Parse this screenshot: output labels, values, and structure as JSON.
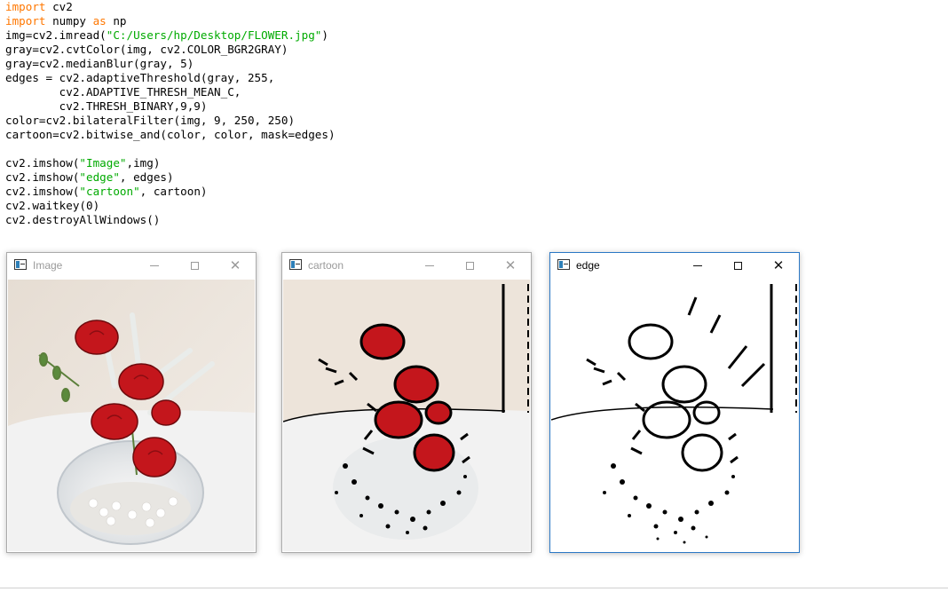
{
  "code_lines": [
    [
      {
        "t": "import",
        "c": "kw"
      },
      {
        "t": " cv2",
        "c": ""
      }
    ],
    [
      {
        "t": "import",
        "c": "kw"
      },
      {
        "t": " numpy ",
        "c": ""
      },
      {
        "t": "as",
        "c": "kw"
      },
      {
        "t": " np",
        "c": ""
      }
    ],
    [
      {
        "t": "img=cv2.imread(",
        "c": ""
      },
      {
        "t": "\"C:/Users/hp/Desktop/FLOWER.jpg\"",
        "c": "str"
      },
      {
        "t": ")",
        "c": ""
      }
    ],
    [
      {
        "t": "gray=cv2.cvtColor(img, cv2.COLOR_BGR2GRAY)",
        "c": ""
      }
    ],
    [
      {
        "t": "gray=cv2.medianBlur(gray, 5)",
        "c": ""
      }
    ],
    [
      {
        "t": "edges = cv2.adaptiveThreshold(gray, 255,",
        "c": ""
      }
    ],
    [
      {
        "t": "        cv2.ADAPTIVE_THRESH_MEAN_C,",
        "c": ""
      }
    ],
    [
      {
        "t": "        cv2.THRESH_BINARY,9,9)",
        "c": ""
      }
    ],
    [
      {
        "t": "color=cv2.bilateralFilter(img, 9, 250, 250)",
        "c": ""
      }
    ],
    [
      {
        "t": "cartoon=cv2.bitwise_and(color, color, mask=edges)",
        "c": ""
      }
    ],
    [],
    [
      {
        "t": "cv2.imshow(",
        "c": ""
      },
      {
        "t": "\"Image\"",
        "c": "str"
      },
      {
        "t": ",img)",
        "c": ""
      }
    ],
    [
      {
        "t": "cv2.imshow(",
        "c": ""
      },
      {
        "t": "\"edge\"",
        "c": "str"
      },
      {
        "t": ", edges)",
        "c": ""
      }
    ],
    [
      {
        "t": "cv2.imshow(",
        "c": ""
      },
      {
        "t": "\"cartoon\"",
        "c": "str"
      },
      {
        "t": ", cartoon)",
        "c": ""
      }
    ],
    [
      {
        "t": "cv2.waitkey(0)",
        "c": ""
      }
    ],
    [
      {
        "t": "cv2.destroyAllWindows()",
        "c": ""
      }
    ]
  ],
  "windows": {
    "image": {
      "title": "Image"
    },
    "cartoon": {
      "title": "cartoon"
    },
    "edge": {
      "title": "edge"
    }
  },
  "colors": {
    "keyword": "#ff7700",
    "string": "#00aa00",
    "active_border": "#2b78c5",
    "inactive_title": "#9a9a9a",
    "rose_red": "#c4161c"
  },
  "icons": [
    "app-icon",
    "minimize-icon",
    "maximize-icon",
    "close-icon"
  ]
}
